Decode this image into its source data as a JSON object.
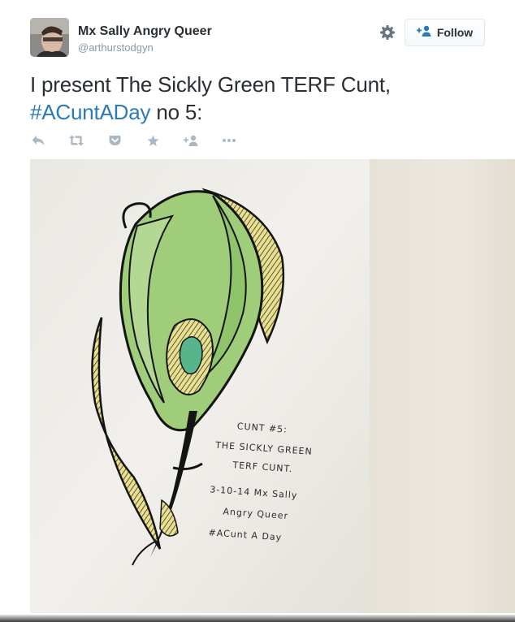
{
  "author": {
    "display_name": "Mx Sally Angry Queer",
    "screen_name": "@arthurstodgyn",
    "avatar_icon": "user-avatar"
  },
  "header": {
    "settings_icon": "gear-icon",
    "follow_label": "Follow",
    "follow_icon": "add-user-icon"
  },
  "tweet": {
    "text_line1": "I present The Sickly Green TERF Cunt,",
    "hashtag": "#ACuntADay",
    "text_after_hashtag": " no 5:"
  },
  "actions": [
    {
      "name": "reply",
      "icon": "reply-icon"
    },
    {
      "name": "retweet",
      "icon": "retweet-icon"
    },
    {
      "name": "pocket",
      "icon": "pocket-icon"
    },
    {
      "name": "favorite",
      "icon": "star-icon"
    },
    {
      "name": "follow",
      "icon": "add-user-icon"
    },
    {
      "name": "more",
      "icon": "more-icon"
    }
  ],
  "photo": {
    "handwriting": {
      "line1": "CUNT #5:",
      "line2": "THE SICKLY GREEN",
      "line3": "TERF CUNT.",
      "line4": "3-10-14 Mx Sally",
      "line5": "Angry Queer",
      "line6": "#ACunt A Day"
    }
  },
  "colors": {
    "link": "#2b7bb9",
    "text": "#292f33",
    "muted": "#8899a6",
    "action_icon": "#aab8c2",
    "drawing_green": "#9fcd7a",
    "drawing_yellow": "#e8e08e"
  }
}
